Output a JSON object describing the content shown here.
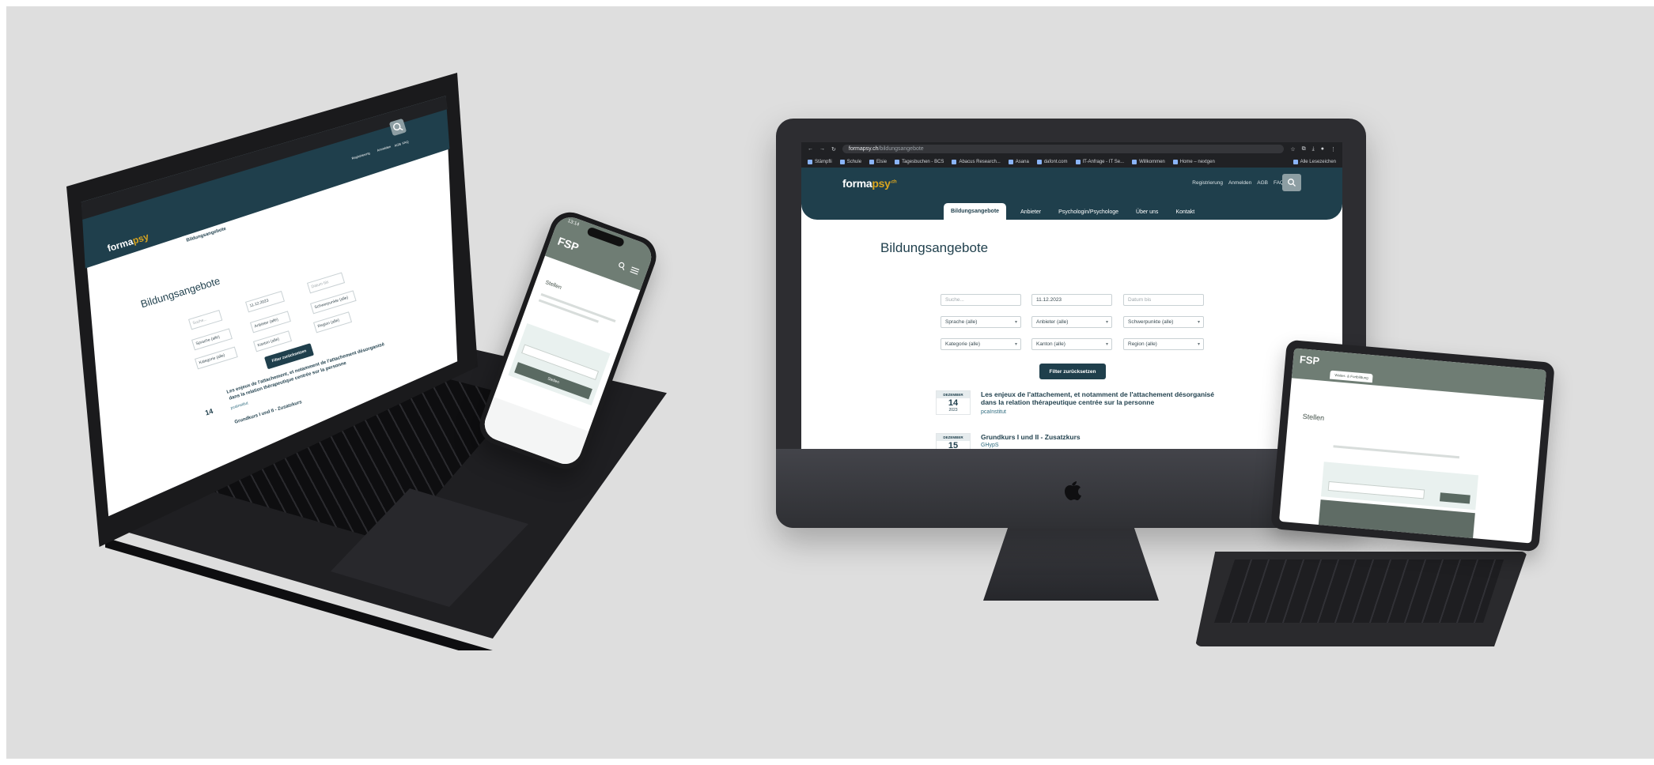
{
  "colors": {
    "background": "#dedede",
    "brand_dark": "#1f3f4c",
    "brand_accent": "#d9a520",
    "device_gray": "#2d2d31",
    "mobile_header": "#6f7d74"
  },
  "imac": {
    "browser": {
      "url_domain": "formapsy.ch",
      "url_path": "/bildungsangebote",
      "bookmarks": [
        "Stämpfli",
        "Schule",
        "Elsie",
        "Tagesbuchen - BCS",
        "Abacus Research...",
        "Asana",
        "dafont.com",
        "IT-Anfrage - IT Se...",
        "Willkommen",
        "Home – nextgen"
      ],
      "bookmarks_right": "Alle Lesezeichen"
    },
    "site": {
      "logo_main": "forma",
      "logo_accent": "psy",
      "logo_suffix": ".ch",
      "top_links": [
        "Registrierung",
        "Anmelden",
        "AGB",
        "FAQ"
      ],
      "search_icon": "search-icon",
      "tabs": [
        "Bildungsangebote",
        "Anbieter",
        "Psychologin/Psychologe",
        "Über uns",
        "Kontakt"
      ],
      "active_tab": "Bildungsangebote",
      "page_title": "Bildungsangebote",
      "filters": {
        "search_placeholder": "Suche...",
        "date_from": "11.12.2023",
        "date_to_placeholder": "Datum bis",
        "language": "Sprache (alle)",
        "provider": "Anbieter (alle)",
        "focus": "Schwerpunkte (alle)",
        "category": "Kategorie (alle)",
        "canton": "Kanton (alle)",
        "region": "Region (alle)",
        "reset_button": "Filter zurücksetzen"
      },
      "events": [
        {
          "month": "DEZEMBER",
          "day": "14",
          "year": "2023",
          "title": "Les enjeux de l'attachement, et notamment de l'attachement désorganisé dans la relation thérapeutique centrée sur la personne",
          "provider": "pcaInstitut"
        },
        {
          "month": "DEZEMBER",
          "day": "15",
          "year": "",
          "title": "Grundkurs I und II - Zusatzkurs",
          "provider": "GHypS"
        }
      ]
    }
  },
  "laptop": {
    "logo_main": "forma",
    "logo_accent": "psy",
    "tabs": [
      "Bildungsangebote",
      "Anbieter",
      "Psychologin/Psychologe",
      "Über uns",
      "Kontakt"
    ],
    "top_links": [
      "Registrierung",
      "Anmelden",
      "AGB",
      "FAQ"
    ],
    "page_title": "Bildungsangebote",
    "filters": [
      "Suche...",
      "11.12.2023",
      "Datum bis",
      "Sprache (alle)",
      "Anbieter (alle)",
      "Schwerpunkte (alle)",
      "Kategorie (alle)",
      "Kanton (alle)",
      "Region (alle)"
    ],
    "reset_button": "Filter zurücksetzen",
    "event1_title_l1": "Les enjeux de l'attachement, et notamment de l'attachement désorganisé",
    "event1_title_l2": "dans la relation thérapeutique centrée sur la personne",
    "event1_provider": "pcaInstitut",
    "event1_day": "14",
    "event2_title": "Grundkurs I und II - Zusatzkurs"
  },
  "tablet": {
    "logo": "FSP",
    "active_tab": "Weiter- & Fortbildung",
    "page_title": "Stellen"
  },
  "phone": {
    "time": "13:14",
    "logo": "FSP",
    "page_title": "Stellen",
    "button": "Stellen"
  }
}
